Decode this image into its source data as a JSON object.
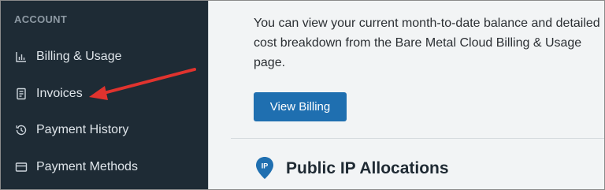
{
  "sidebar": {
    "section_title": "ACCOUNT",
    "items": [
      {
        "label": "Billing & Usage",
        "icon": "bar-chart-icon"
      },
      {
        "label": "Invoices",
        "icon": "invoice-icon"
      },
      {
        "label": "Payment History",
        "icon": "history-icon"
      },
      {
        "label": "Payment Methods",
        "icon": "credit-card-icon"
      }
    ]
  },
  "main": {
    "description": "You can view your current month-to-date balance and detailed cost breakdown from the Bare Metal Cloud Billing & Usage page.",
    "button_label": "View Billing",
    "section_heading": "Public IP Allocations",
    "ip_badge": "IP"
  },
  "colors": {
    "sidebar_bg": "#1e2b35",
    "button_bg": "#1f6fb0",
    "annotation_arrow": "#e0332e"
  }
}
